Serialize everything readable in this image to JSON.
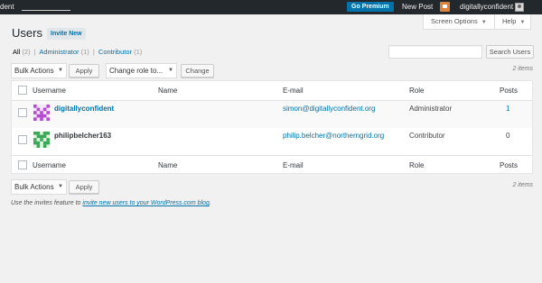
{
  "adminbar": {
    "site_name": "dent",
    "premium_label": "Go Premium",
    "new_post_label": "New Post",
    "user_name": "digitallyconfident"
  },
  "screen_meta": {
    "screen_options_label": "Screen Options",
    "help_label": "Help"
  },
  "page": {
    "title": "Users",
    "invite_label": "Invite New"
  },
  "filters": {
    "all_label": "All",
    "all_count": "(2)",
    "administrator_label": "Administrator",
    "administrator_count": "(1)",
    "contributor_label": "Contributor",
    "contributor_count": "(1)",
    "separator": "|"
  },
  "search": {
    "placeholder": "",
    "button_label": "Search Users"
  },
  "tablenav": {
    "bulk_actions": "Bulk Actions",
    "apply_label": "Apply",
    "change_role_select": "Change role to...",
    "change_label": "Change",
    "items_count": "2 items"
  },
  "table": {
    "columns": {
      "username": "Username",
      "name": "Name",
      "email": "E-mail",
      "role": "Role",
      "posts": "Posts"
    },
    "rows": [
      {
        "username": "digitallyconfident",
        "name": "",
        "email": "simon@digitallyconfident.org",
        "role": "Administrator",
        "posts": "1"
      },
      {
        "username": "philipbelcher163",
        "name": "",
        "email": "philip.belcher@northerngrid.org",
        "role": "Contributor",
        "posts": "0"
      }
    ]
  },
  "footer": {
    "prefix": "Use the invites feature to ",
    "link": "invite new users to your WordPress.com blog",
    "suffix": "."
  },
  "colors": {
    "adminbar_bg": "#23282d",
    "link": "#0073aa",
    "premium_bg": "#0073aa",
    "notification": "#dd823b"
  },
  "icons": {
    "notification": "notification-icon",
    "avatar_1": "identicon-purple",
    "avatar_2": "identicon-green"
  }
}
